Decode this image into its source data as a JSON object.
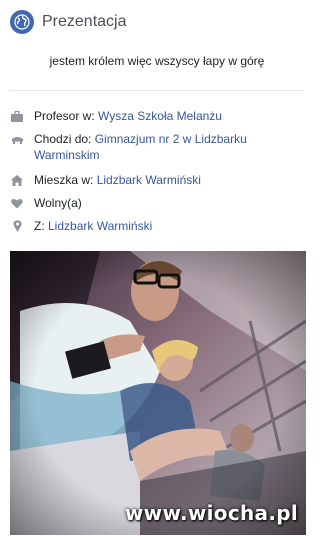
{
  "header": {
    "title": "Prezentacja",
    "icon": "globe-icon"
  },
  "bio": "jestem królem więc wszyscy łapy w górę",
  "details": [
    {
      "icon": "briefcase-icon",
      "label": "Profesor w: ",
      "link": "Wysza Szkoła Melanżu"
    },
    {
      "icon": "graduation-cap-icon",
      "label": "Chodzi do: ",
      "link": "Gimnazjum nr 2 w Lidzbarku Warminskim"
    },
    {
      "icon": "home-icon",
      "label": "Mieszka w: ",
      "link": "Lidzbark Warmiński"
    },
    {
      "icon": "heart-icon",
      "label": "Wolny(a)",
      "link": ""
    },
    {
      "icon": "location-pin-icon",
      "label": "Z: ",
      "link": "Lidzbark Warmiński"
    }
  ],
  "photo": {
    "watermark": "www.wiocha.pl"
  },
  "colors": {
    "link": "#365899",
    "icon": "#90949c",
    "accent": "#4267b2"
  }
}
